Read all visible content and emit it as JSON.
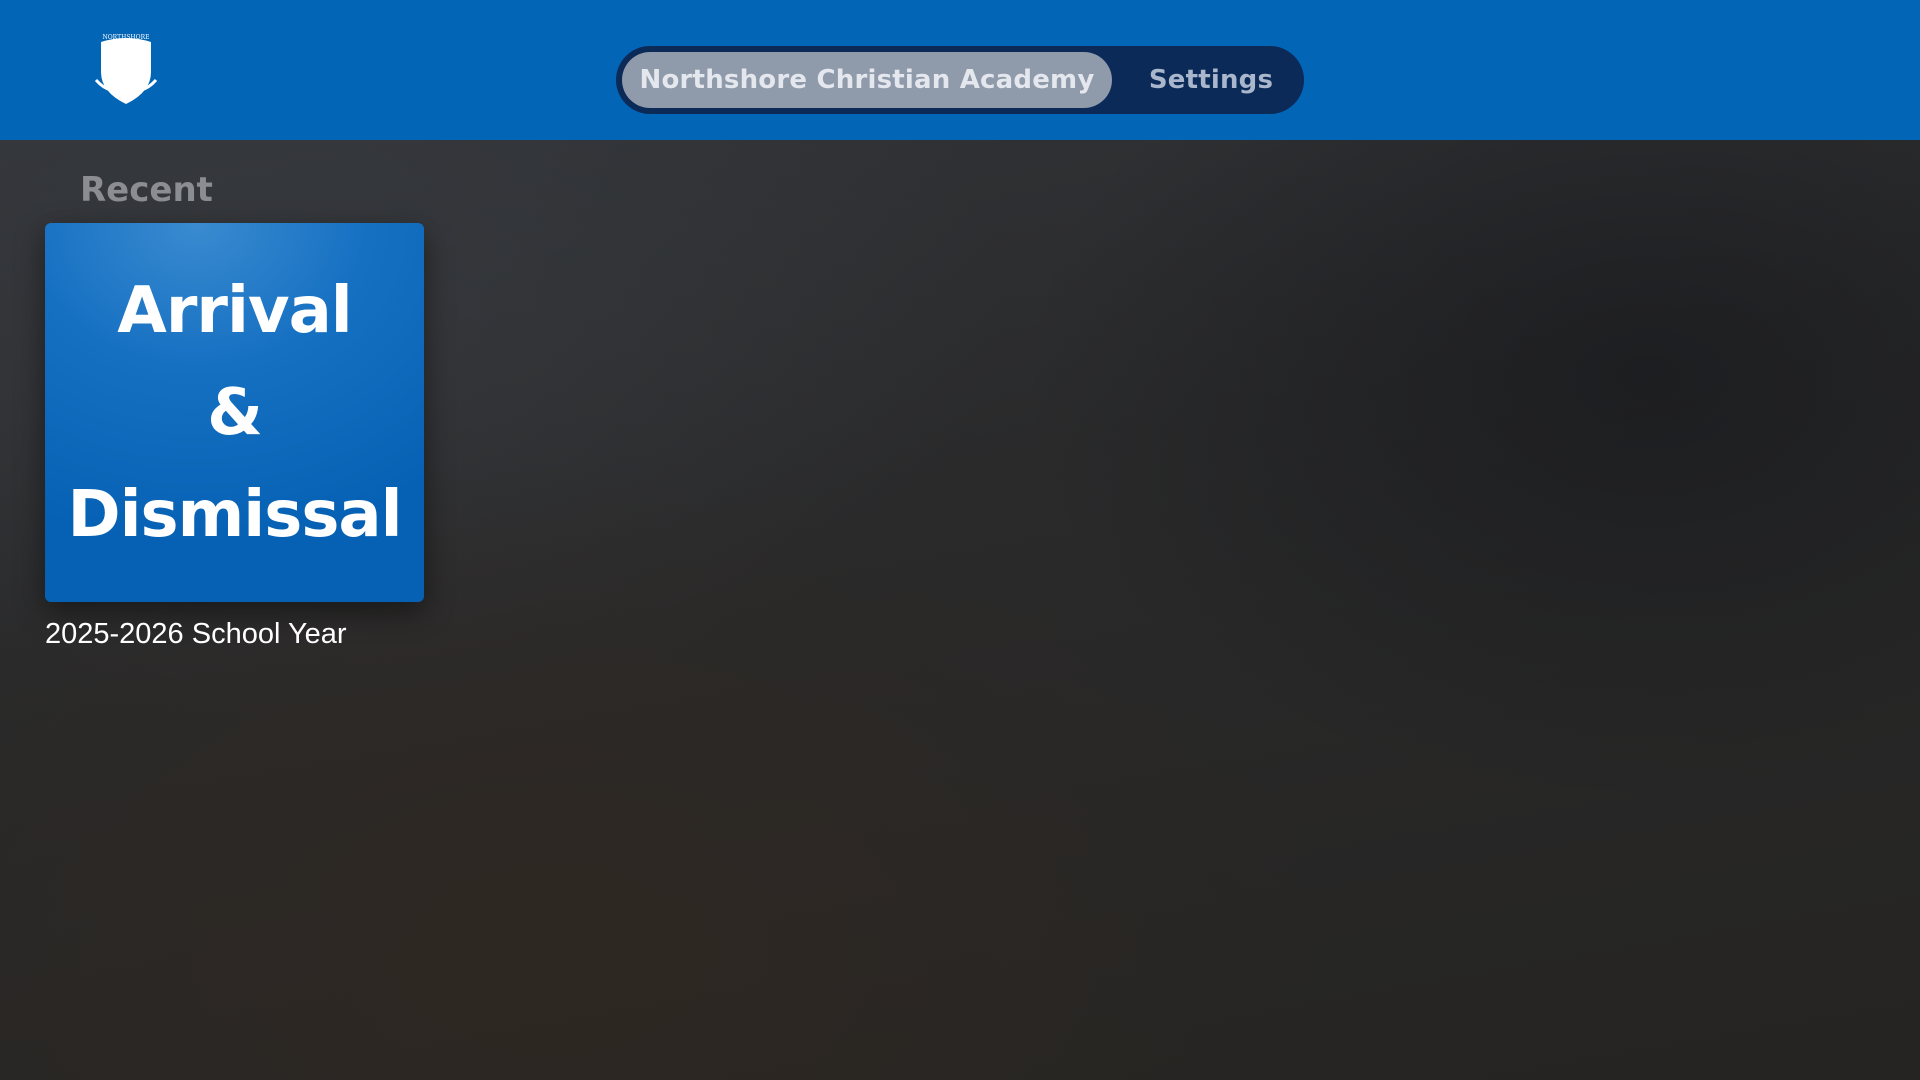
{
  "header": {
    "logo": {
      "icon": "shield-icon",
      "text": "NORTHSHORE",
      "color": "#ffffff"
    },
    "tabs": [
      {
        "label": "Northshore Christian Academy",
        "selected": true
      },
      {
        "label": "Settings",
        "selected": false
      }
    ],
    "bar_color": "#0265b5"
  },
  "main": {
    "section_title": "Recent",
    "items": [
      {
        "tile_lines": [
          "Arrival",
          "&",
          "Dismissal"
        ],
        "caption": "2025-2026 School Year",
        "tile_color": "#1670c2"
      }
    ]
  }
}
